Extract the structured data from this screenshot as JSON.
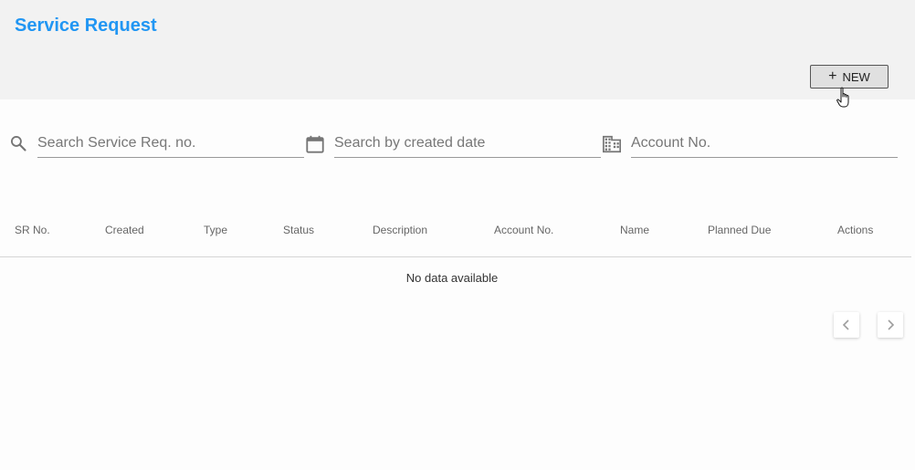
{
  "header": {
    "title": "Service Request",
    "new_button_label": "NEW"
  },
  "filters": {
    "service_req_placeholder": "Search Service Req. no.",
    "created_date_placeholder": "Search by created date",
    "account_placeholder": "Account No."
  },
  "table": {
    "columns": [
      "SR No.",
      "Created",
      "Type",
      "Status",
      "Description",
      "Account No.",
      "Name",
      "Planned Due",
      "Actions"
    ],
    "empty_message": "No data available"
  },
  "colors": {
    "title_accent": "#2196f3",
    "header_background": "#f2f2f2"
  },
  "icons": {
    "search": "search-icon",
    "calendar": "calendar-icon",
    "building": "building-icon",
    "prev": "chevron-left-icon",
    "next": "chevron-right-icon"
  }
}
